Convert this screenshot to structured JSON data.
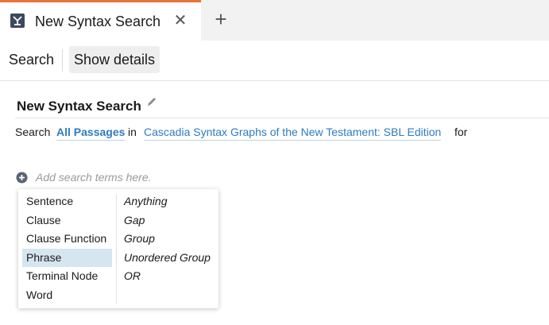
{
  "tab": {
    "title": "New Syntax Search",
    "close_glyph": "✕",
    "new_tab_glyph": "+"
  },
  "toolbar": {
    "search_label": "Search",
    "details_label": "Show details"
  },
  "search": {
    "title": "New Syntax Search",
    "prefix": "Search",
    "scope": "All Passages",
    "in_word": "in",
    "resource": "Cascadia Syntax Graphs of the New Testament: SBL Edition",
    "for_word": "for",
    "add_placeholder": "Add search terms here."
  },
  "menu": {
    "left_items": [
      "Sentence",
      "Clause",
      "Clause Function",
      "Phrase",
      "Terminal Node",
      "Word"
    ],
    "right_items": [
      "Anything",
      "Gap",
      "Group",
      "Unordered Group",
      "OR"
    ],
    "selected": "Phrase"
  },
  "colors": {
    "accent_tab": "#e8743b",
    "link": "#2d7cc1",
    "selected_bg": "#d6e6f0"
  }
}
